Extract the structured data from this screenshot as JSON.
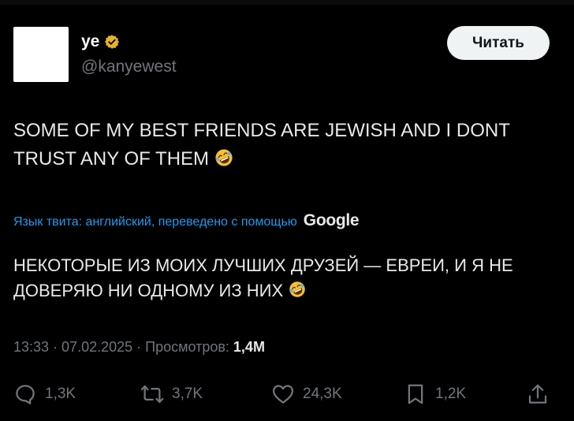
{
  "user": {
    "display_name": "ye",
    "handle": "@kanyewest",
    "verified": true
  },
  "header": {
    "read_button_label": "Читать"
  },
  "tweet": {
    "line1": "SOME OF MY BEST FRIENDS ARE JEWISH AND I DONT",
    "line2": "TRUST ANY OF THEM",
    "emoji": "rolling-on-the-floor-laughing"
  },
  "translation": {
    "label": "Язык твита: английский, переведено с помощью",
    "provider": "Google",
    "line1": "НЕКОТОРЫЕ ИЗ МОИХ ЛУЧШИХ ДРУЗЕЙ — ЕВРЕИ, И Я НЕ",
    "line2": "ДОВЕРЯЮ НИ ОДНОМУ ИЗ НИХ"
  },
  "meta": {
    "time": "13:33",
    "separator": "·",
    "date": "07.02.2025",
    "views_label": "Просмотров:",
    "views_value": "1,4M"
  },
  "actions": {
    "reply_count": "1,3K",
    "repost_count": "3,7K",
    "like_count": "24,3K",
    "bookmark_count": "1,2K"
  },
  "colors": {
    "background": "#000000",
    "text": "#e7e9ea",
    "secondary": "#71767b",
    "link": "#1d9bf0",
    "verified_gold": "#e8b32a"
  }
}
